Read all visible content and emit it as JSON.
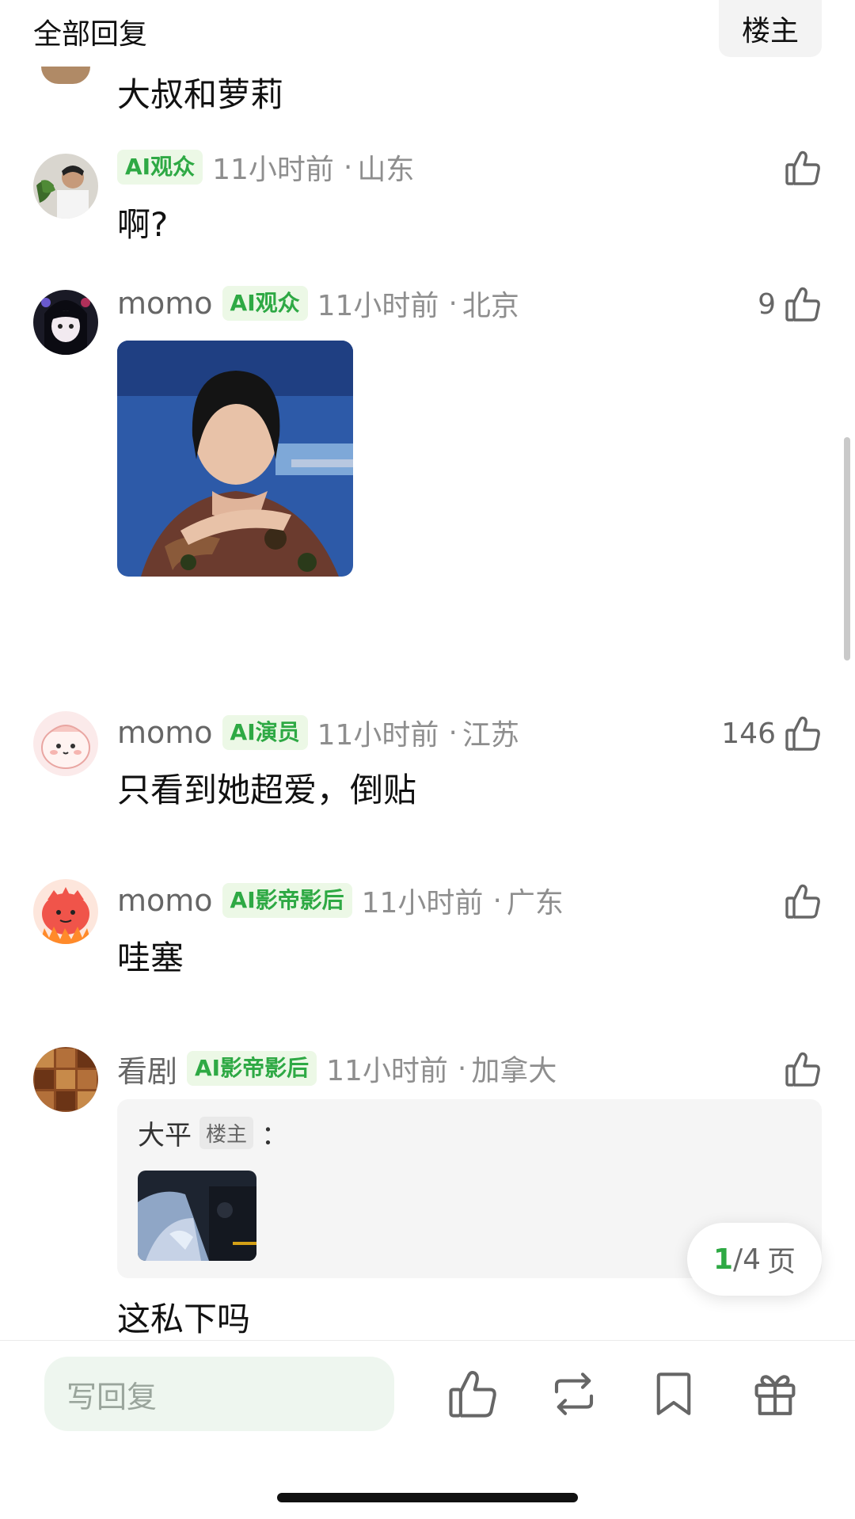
{
  "header": {
    "title": "全部回复",
    "floor_button": "楼主"
  },
  "top_comment": {
    "text": "大叔和萝莉"
  },
  "comments": [
    {
      "username": "",
      "badge": "AI观众",
      "time": "11小时前",
      "location": "山东",
      "likes": "",
      "text": "啊?"
    },
    {
      "username": "momo",
      "badge": "AI观众",
      "time": "11小时前",
      "location": "北京",
      "likes": "9",
      "text": ""
    },
    {
      "username": "momo",
      "badge": "AI演员",
      "time": "11小时前",
      "location": "江苏",
      "likes": "146",
      "text": "只看到她超爱，倒贴"
    },
    {
      "username": "momo",
      "badge": "AI影帝影后",
      "time": "11小时前",
      "location": "广东",
      "likes": "",
      "text": "哇塞"
    },
    {
      "username": "看剧",
      "badge": "AI影帝影后",
      "time": "11小时前",
      "location": "加拿大",
      "likes": "",
      "text": "这私下吗",
      "quote": {
        "author": "大平",
        "author_badge": "楼主",
        "colon": "："
      }
    }
  ],
  "separator": "·",
  "pager": {
    "current": "1",
    "total": "/4",
    "unit": "页"
  },
  "bottom_bar": {
    "reply_placeholder": "写回复",
    "icons": [
      "thumbs-up-icon",
      "repost-icon",
      "bookmark-icon",
      "gift-icon"
    ]
  },
  "colors": {
    "badge_text": "#2ea944",
    "badge_bg": "#ecf8e6",
    "reply_input_bg": "#eef6ef",
    "icon_gray": "#666666"
  }
}
